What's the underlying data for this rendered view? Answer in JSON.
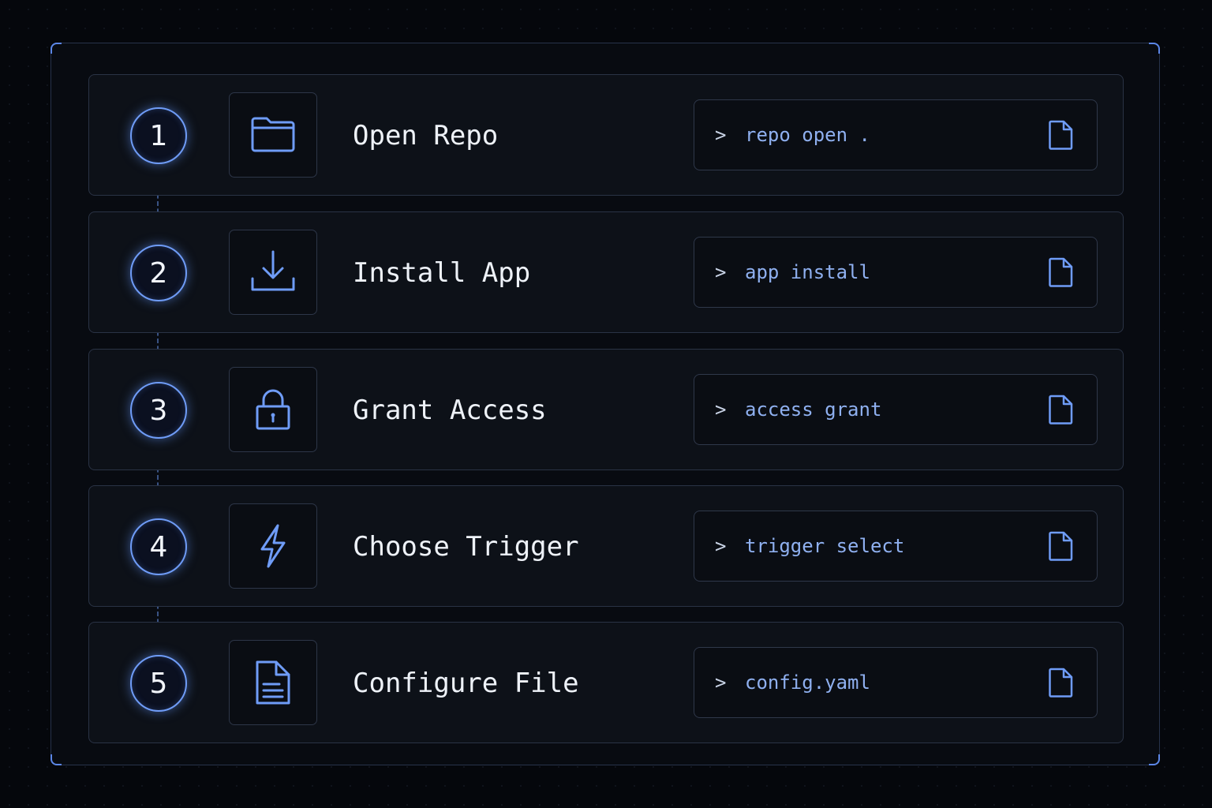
{
  "colors": {
    "accent": "#6f9cf7",
    "background": "#05070c",
    "panel": "#0d1118",
    "title_text": "#eef2f8",
    "command_text": "#8fb0f0"
  },
  "steps": [
    {
      "number": "1",
      "icon": "folder-icon",
      "title": "Open Repo",
      "prompt": ">",
      "command": "repo open ."
    },
    {
      "number": "2",
      "icon": "download-icon",
      "title": "Install App",
      "prompt": ">",
      "command": "app install"
    },
    {
      "number": "3",
      "icon": "lock-icon",
      "title": "Grant Access",
      "prompt": ">",
      "command": "access grant"
    },
    {
      "number": "4",
      "icon": "lightning-icon",
      "title": "Choose Trigger",
      "prompt": ">",
      "command": "trigger select"
    },
    {
      "number": "5",
      "icon": "document-icon",
      "title": "Configure File",
      "prompt": ">",
      "command": "config.yaml"
    }
  ],
  "copy_icon": "file-icon"
}
